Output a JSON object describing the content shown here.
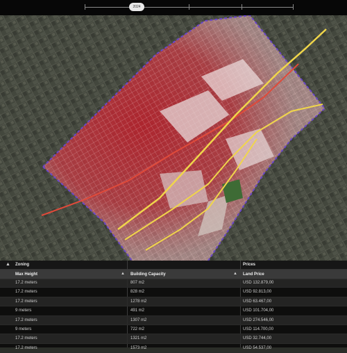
{
  "timeline": {
    "year": "2024"
  },
  "map": {
    "colors": {
      "district_fill": "#c0333a",
      "boundary": "#6a47c9",
      "rail_main": "#f0d64a",
      "rail_secondary": "#e04a3a"
    }
  },
  "table": {
    "groups": [
      "Zoning",
      "Prices"
    ],
    "columns": [
      "Max Height",
      "Building Capacity",
      "Land Price"
    ],
    "rows": [
      [
        "17.2 meters",
        "807 m2",
        "USD 132.879,00"
      ],
      [
        "17.2 meters",
        "828 m2",
        "USD 92.813,00"
      ],
      [
        "17.2 meters",
        "1278 m2",
        "USD 63.467,00"
      ],
      [
        "9 meters",
        "491 m2",
        "USD 101.704,00"
      ],
      [
        "17.2 meters",
        "1307 m2",
        "USD 274.546,00"
      ],
      [
        "9 meters",
        "722 m2",
        "USD 114.700,00"
      ],
      [
        "17.2 meters",
        "1321 m2",
        "USD 32.744,00"
      ],
      [
        "17.2 meters",
        "1573 m2",
        "USD 54.537,00"
      ]
    ]
  }
}
